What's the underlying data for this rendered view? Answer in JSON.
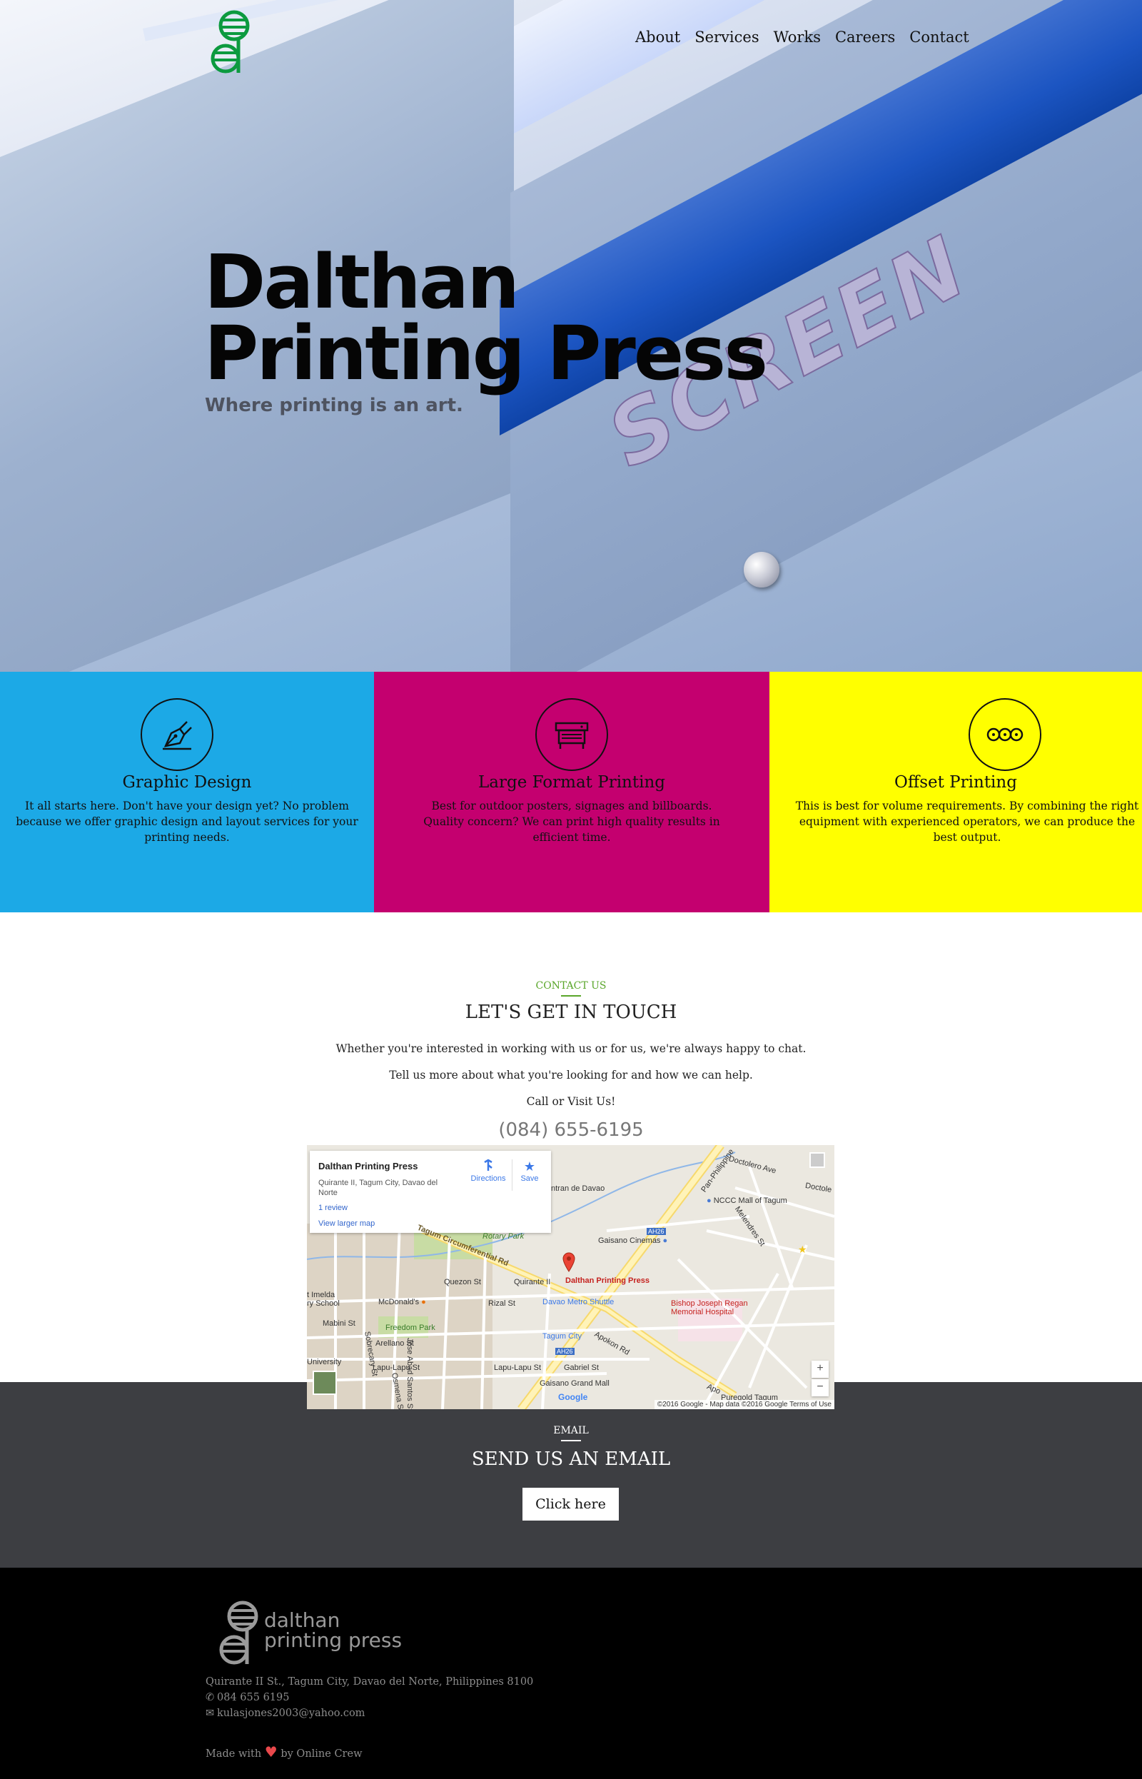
{
  "nav": {
    "items": [
      {
        "label": "About"
      },
      {
        "label": "Services"
      },
      {
        "label": "Works"
      },
      {
        "label": "Careers"
      },
      {
        "label": "Contact"
      }
    ]
  },
  "hero": {
    "title_line1": "Dalthan",
    "title_line2": "Printing Press",
    "subtitle": "Where printing is an art.",
    "background_text": "SCREEN"
  },
  "services": [
    {
      "title": "Graphic Design",
      "icon": "pen-nib-icon",
      "description": "It all starts here. Don't have your design yet? No problem because we offer graphic design and layout services for your printing needs.",
      "color": "#1ca9e6"
    },
    {
      "title": "Large Format Printing",
      "icon": "printer-icon",
      "description": "Best for outdoor posters, signages and billboards. Quality concern? We can print high quality results in efficient time.",
      "color": "#c4006f"
    },
    {
      "title": "Offset Printing",
      "icon": "rollers-icon",
      "description": "This is best for volume requirements. By combining the right equipment with experienced operators, we can produce the best output.",
      "color": "#ffff00"
    }
  ],
  "contact": {
    "eyebrow": "CONTACT US",
    "heading": "LET'S GET IN TOUCH",
    "line1": "Whether you're interested in working with us or for us, we're always happy to chat.",
    "line2": "Tell us more about what you're looking for and how we can help.",
    "line3": "Call or Visit Us!",
    "phone": "(084) 655-6195",
    "accent": "#5aa62a"
  },
  "map": {
    "place_name": "Dalthan Printing Press",
    "address": "Quirante II, Tagum City, Davao del Norte",
    "reviews": "1 review",
    "view_larger": "View larger map",
    "directions": "Directions",
    "save": "Save",
    "attribution": "©2016 Google - Map data ©2016 Google",
    "terms": "Terms of Use",
    "google": "Google",
    "zoom_in": "+",
    "zoom_out": "−",
    "labels": {
      "pan_philippine": "Pan-Philippine",
      "doctolero": "Doctolero Ave",
      "doctole": "Doctole",
      "ntran": "ntran de Davao",
      "nccc": "NCCC Mall of Tagum",
      "melendres": "Melendres St",
      "ah26a": "AH26",
      "gaisano_cinemas": "Gaisano Cinemas",
      "rotary": "Rotary Park",
      "circumferential": "Tagum Circumferential Rd",
      "quezon": "Quezon St",
      "quirante": "Quirante II",
      "pin_label": "Dalthan Printing Press",
      "imelda": "t Imelda",
      "ry_school": "ry School",
      "mcdonalds": "McDonald's",
      "rizal": "Rizal St",
      "dmshuttle": "Davao Metro Shuttle",
      "bishop1": "Bishop Joseph Regan",
      "bishop2": "Memorial Hospital",
      "mabini": "Mabini St",
      "freedom": "Freedom Park",
      "arellano": "Arellano St",
      "jas": "Jose Abad Santos St",
      "tagum_city": "Tagum City",
      "ah26b": "AH26",
      "apokon": "Apokon Rd",
      "university": "University",
      "lapu1": "Lapu-Lapu St",
      "lapu2": "Lapu-Lapu St",
      "gabriel": "Gabriel St",
      "gaisano_grand": "Gaisano Grand Mall",
      "osmena": "Osmena St",
      "sobrecary": "Sobrecary St",
      "puregold": "Puregold Tagum",
      "apo": "Apo"
    }
  },
  "email": {
    "eyebrow": "EMAIL",
    "heading": "SEND US AN EMAIL",
    "button": "Click here"
  },
  "footer": {
    "wordmark_line1": "dalthan",
    "wordmark_line2": "printing press",
    "address": "Quirante II St., Tagum City, Davao del Norte, Philippines 8100",
    "phone": "084 655 6195",
    "email": "kulasjones2003@yahoo.com",
    "made_prefix": "Made with",
    "made_suffix": "by Online Crew"
  }
}
